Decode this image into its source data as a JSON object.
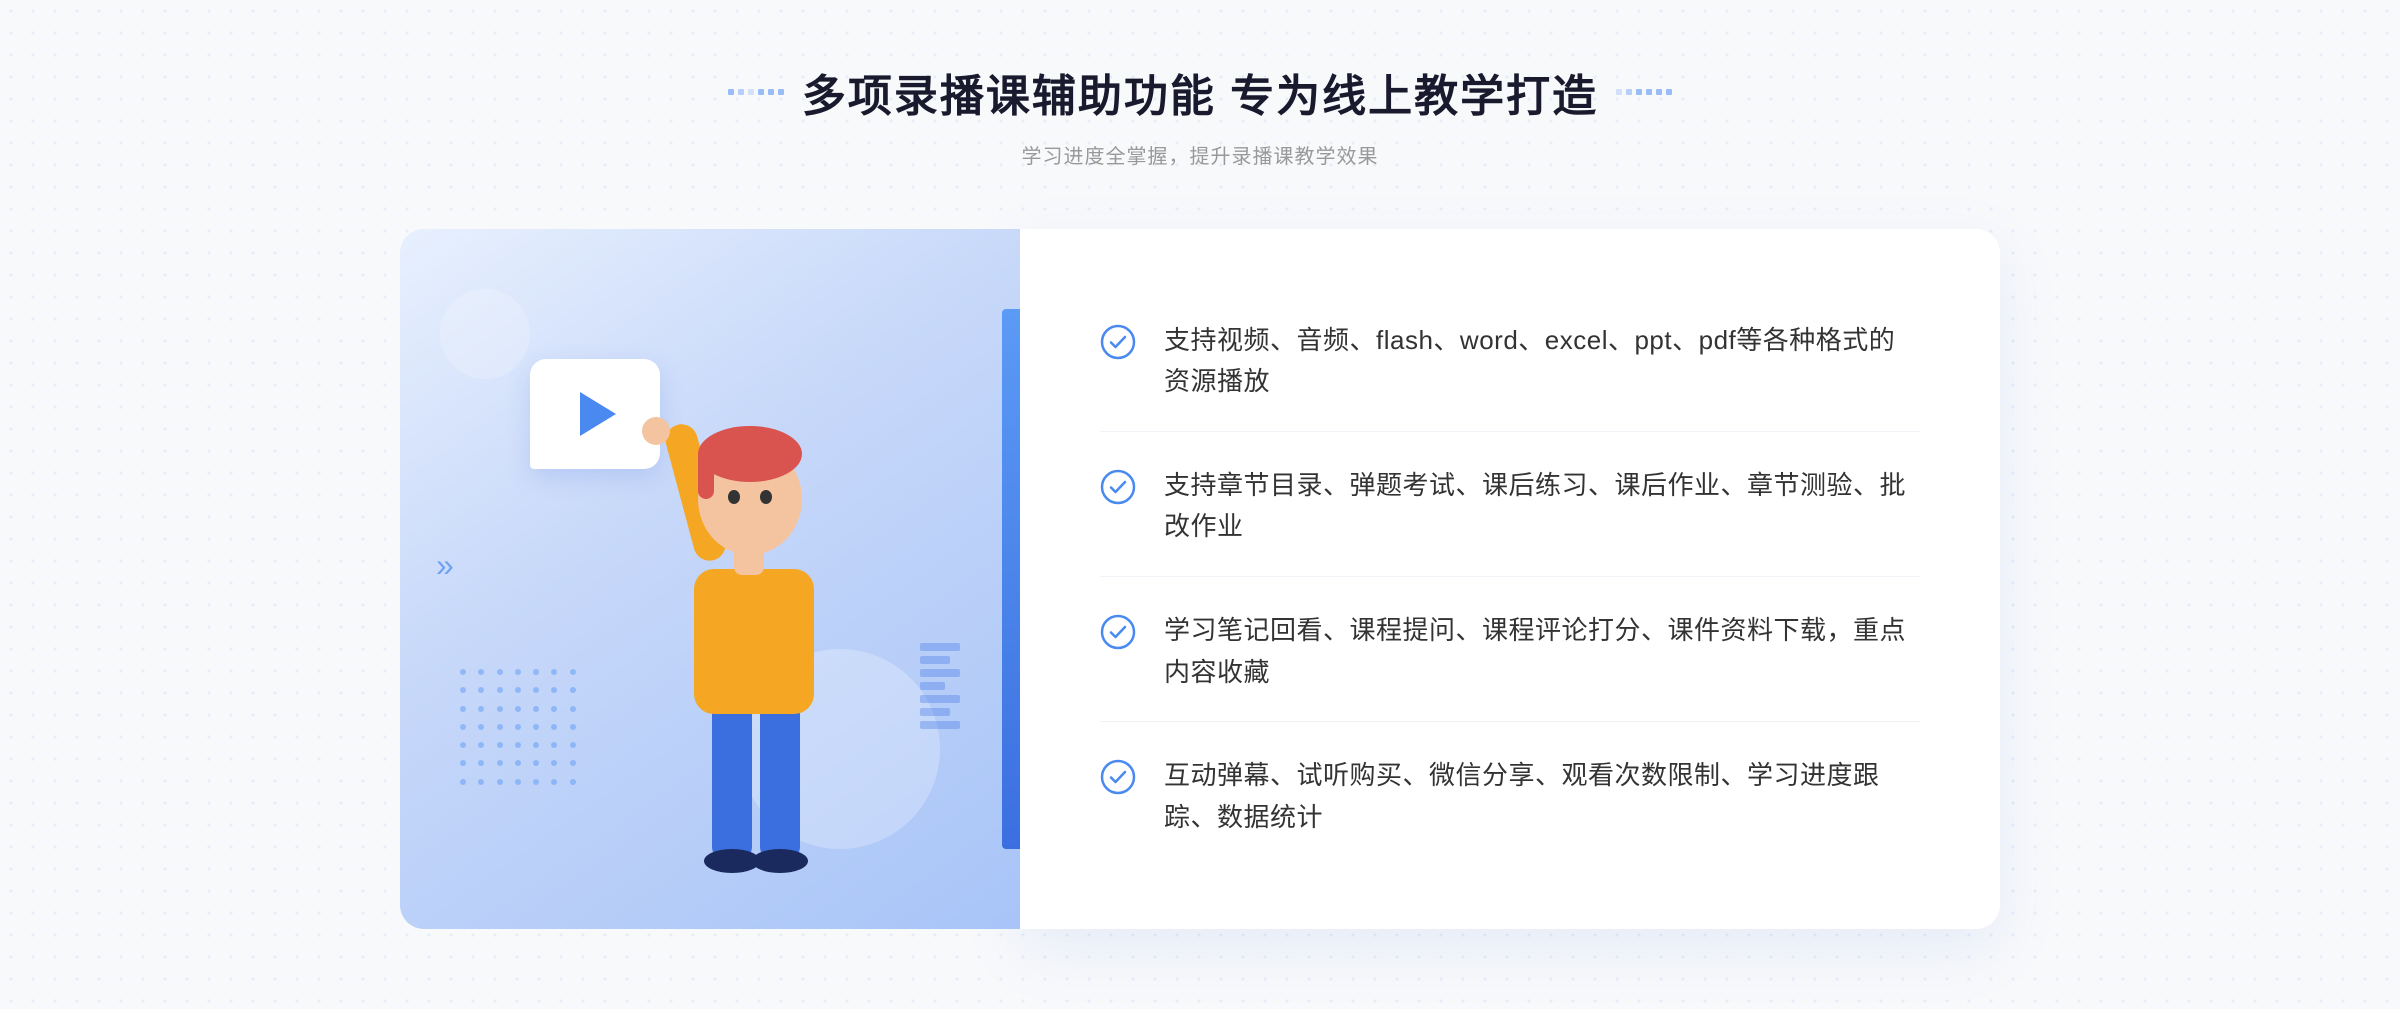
{
  "header": {
    "title": "多项录播课辅助功能 专为线上教学打造",
    "subtitle": "学习进度全掌握，提升录播课教学效果"
  },
  "features": [
    {
      "id": 1,
      "text": "支持视频、音频、flash、word、excel、ppt、pdf等各种格式的资源播放"
    },
    {
      "id": 2,
      "text": "支持章节目录、弹题考试、课后练习、课后作业、章节测验、批改作业"
    },
    {
      "id": 3,
      "text": "学习笔记回看、课程提问、课程评论打分、课件资料下载，重点内容收藏"
    },
    {
      "id": 4,
      "text": "互动弹幕、试听购买、微信分享、观看次数限制、学习进度跟踪、数据统计"
    }
  ],
  "colors": {
    "primary": "#4a8af0",
    "accent": "#3b6fe0",
    "text_dark": "#1a1a2e",
    "text_light": "#999",
    "check_color": "#4a8af0"
  }
}
